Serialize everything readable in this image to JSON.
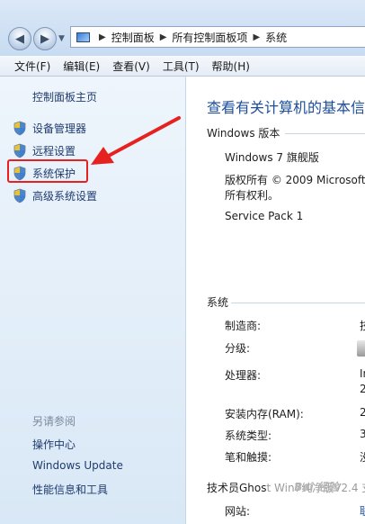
{
  "breadcrumb": [
    "控制面板",
    "所有控制面板项",
    "系统"
  ],
  "menu": [
    "文件(F)",
    "编辑(E)",
    "查看(V)",
    "工具(T)",
    "帮助(H)"
  ],
  "sidebar": {
    "home": "控制面板主页",
    "tasks": [
      {
        "label": "设备管理器",
        "icon": "shield-icon"
      },
      {
        "label": "远程设置",
        "icon": "shield-icon"
      },
      {
        "label": "系统保护",
        "icon": "shield-icon",
        "highlighted": true
      },
      {
        "label": "高级系统设置",
        "icon": "shield-icon"
      }
    ],
    "see_also_heading": "另请参阅",
    "see_also": [
      "操作中心",
      "Windows Update",
      "性能信息和工具"
    ]
  },
  "main": {
    "title": "查看有关计算机的基本信",
    "edition_heading": "Windows 版本",
    "edition_name": "Windows 7 旗舰版",
    "copyright_line1": "版权所有 © 2009 Microsoft",
    "copyright_line2": "所有权利。",
    "service_pack": "Service Pack 1",
    "system_heading": "系统",
    "system_rows": [
      {
        "label": "制造商:",
        "value": "技"
      },
      {
        "label": "分级:",
        "value": ""
      },
      {
        "label": "处理器:",
        "value": "In"
      },
      {
        "label": "安装内存(RAM):",
        "value": "2"
      },
      {
        "label": "系统类型:",
        "value": "3"
      },
      {
        "label": "笔和触摸:",
        "value": "没"
      }
    ],
    "processor_extra": "2",
    "oem_line": "技术员Ghost Win7纯净版V2.4 支",
    "website_label": "网站:",
    "website_value": "联"
  },
  "watermark": "Bai 经验",
  "colors": {
    "highlight": "#e5221f",
    "link": "#1f3b6e",
    "title": "#1e4f9c"
  }
}
